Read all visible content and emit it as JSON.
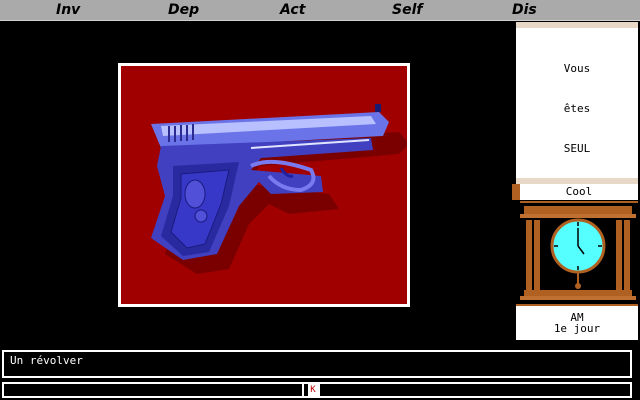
{
  "menu": {
    "items": [
      {
        "label": "Inv"
      },
      {
        "label": "Dep"
      },
      {
        "label": "Act"
      },
      {
        "label": "Self"
      },
      {
        "label": "Dis"
      }
    ]
  },
  "scene": {
    "subject": "pistol-image",
    "background_color": "#a00000"
  },
  "scroll": {
    "lines": [
      "Vous",
      "êtes",
      "SEUL"
    ]
  },
  "status": {
    "mood": "Cool"
  },
  "clock": {
    "face_color": "#55ffff",
    "case_color": "#b06020"
  },
  "time": {
    "period": "AM",
    "day": "1e jour"
  },
  "message": {
    "text": "Un révolver"
  },
  "input": {
    "cursor_char": "K"
  }
}
